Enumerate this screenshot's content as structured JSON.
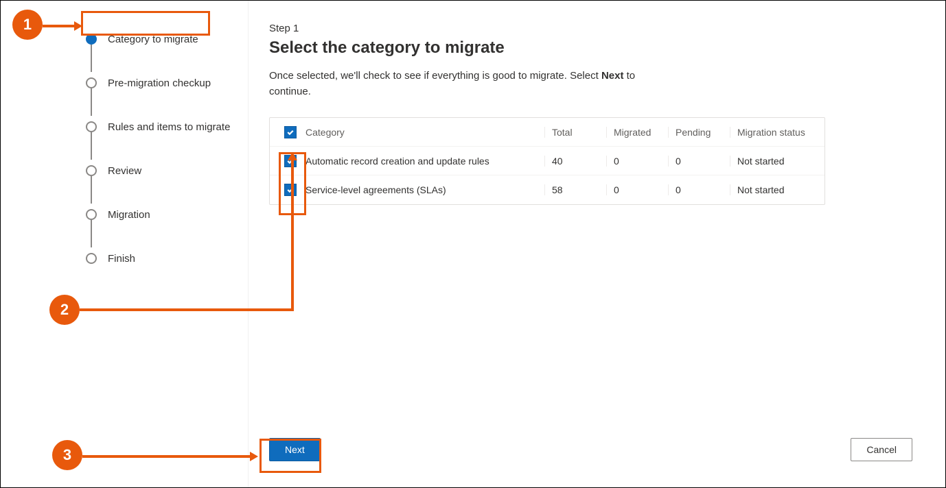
{
  "stepper": {
    "items": [
      {
        "label": "Category to migrate",
        "active": true
      },
      {
        "label": "Pre-migration checkup",
        "active": false
      },
      {
        "label": "Rules and items to migrate",
        "active": false
      },
      {
        "label": "Review",
        "active": false
      },
      {
        "label": "Migration",
        "active": false
      },
      {
        "label": "Finish",
        "active": false
      }
    ]
  },
  "main": {
    "step_label": "Step 1",
    "title": "Select the category to migrate",
    "desc_before": "Once selected, we'll check to see if everything is good to migrate. Select ",
    "desc_bold": "Next",
    "desc_after": " to continue."
  },
  "table": {
    "headers": {
      "category": "Category",
      "total": "Total",
      "migrated": "Migrated",
      "pending": "Pending",
      "status": "Migration status"
    },
    "rows": [
      {
        "category": "Automatic record creation and update rules",
        "total": "40",
        "migrated": "0",
        "pending": "0",
        "status": "Not started"
      },
      {
        "category": "Service-level agreements (SLAs)",
        "total": "58",
        "migrated": "0",
        "pending": "0",
        "status": "Not started"
      }
    ]
  },
  "buttons": {
    "next": "Next",
    "cancel": "Cancel"
  },
  "annotations": {
    "one": "1",
    "two": "2",
    "three": "3"
  }
}
